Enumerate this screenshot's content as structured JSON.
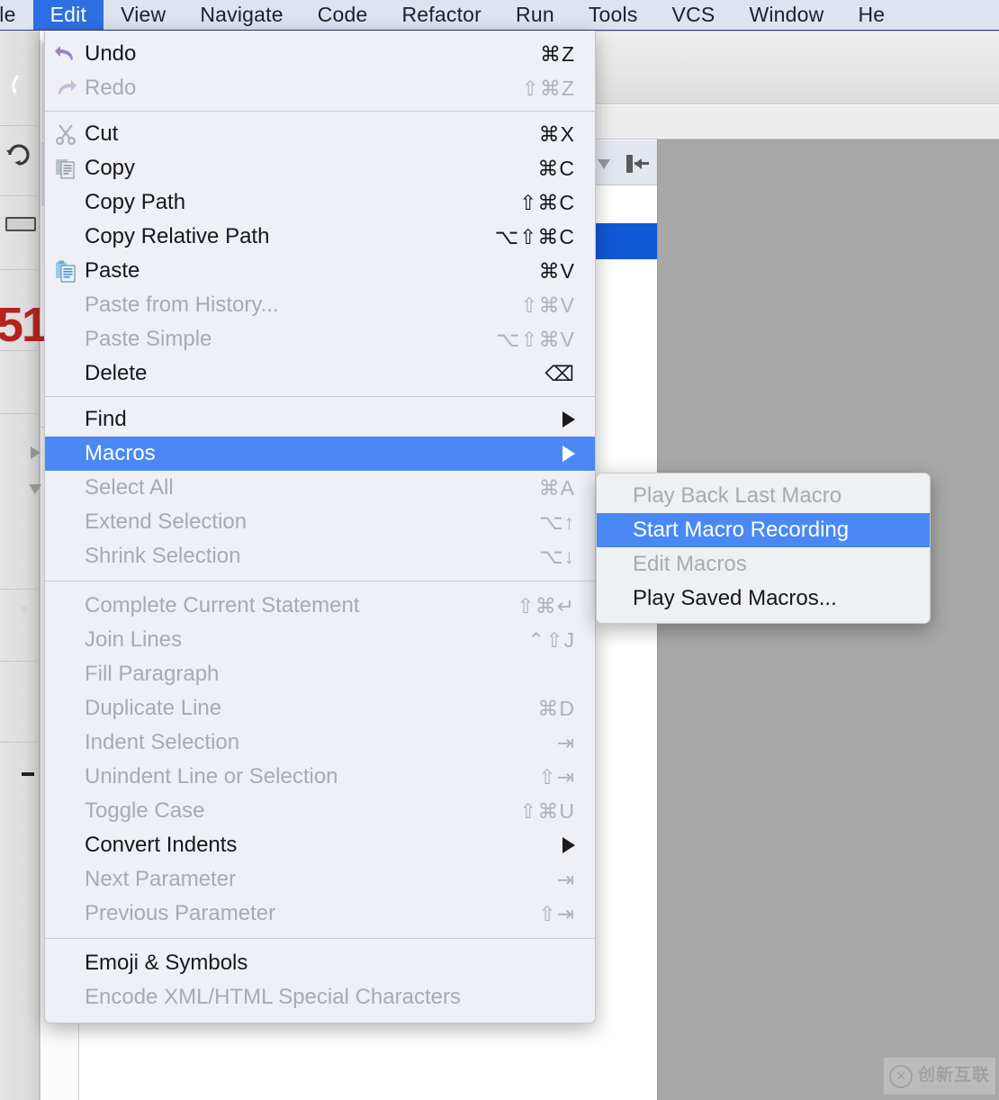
{
  "app": {
    "kind": "ide-menu-screenshot"
  },
  "menubar": {
    "items": [
      {
        "label": "ile",
        "full": "File",
        "selected": false,
        "clipped": true
      },
      {
        "label": "Edit",
        "selected": true
      },
      {
        "label": "View",
        "selected": false
      },
      {
        "label": "Navigate",
        "selected": false
      },
      {
        "label": "Code",
        "selected": false
      },
      {
        "label": "Refactor",
        "selected": false
      },
      {
        "label": "Run",
        "selected": false
      },
      {
        "label": "Tools",
        "selected": false
      },
      {
        "label": "VCS",
        "selected": false
      },
      {
        "label": "Window",
        "selected": false
      },
      {
        "label": "He",
        "full": "Help",
        "selected": false,
        "clipped": true
      }
    ]
  },
  "edit_menu": {
    "groups": [
      {
        "items": [
          {
            "label": "Undo",
            "shortcut": "⌘Z",
            "enabled": true,
            "icon": "undo-icon"
          },
          {
            "label": "Redo",
            "shortcut": "⇧⌘Z",
            "enabled": false,
            "icon": "redo-icon"
          }
        ]
      },
      {
        "items": [
          {
            "label": "Cut",
            "shortcut": "⌘X",
            "enabled": true,
            "icon": "cut-icon"
          },
          {
            "label": "Copy",
            "shortcut": "⌘C",
            "enabled": true,
            "icon": "copy-icon"
          },
          {
            "label": "Copy Path",
            "shortcut": "⇧⌘C",
            "enabled": true,
            "icon": null
          },
          {
            "label": "Copy Relative Path",
            "shortcut": "⌥⇧⌘C",
            "enabled": true,
            "icon": null
          },
          {
            "label": "Paste",
            "shortcut": "⌘V",
            "enabled": true,
            "icon": "paste-icon"
          },
          {
            "label": "Paste from History...",
            "shortcut": "⇧⌘V",
            "enabled": false,
            "icon": null
          },
          {
            "label": "Paste Simple",
            "shortcut": "⌥⇧⌘V",
            "enabled": false,
            "icon": null
          },
          {
            "label": "Delete",
            "shortcut": "⌫",
            "enabled": true,
            "icon": null
          }
        ]
      },
      {
        "items": [
          {
            "label": "Find",
            "shortcut": null,
            "enabled": true,
            "submenu": true
          },
          {
            "label": "Macros",
            "shortcut": null,
            "enabled": true,
            "submenu": true,
            "highlighted": true
          },
          {
            "label": "Select All",
            "shortcut": "⌘A",
            "enabled": false
          },
          {
            "label": "Extend Selection",
            "shortcut": "⌥↑",
            "enabled": false
          },
          {
            "label": "Shrink Selection",
            "shortcut": "⌥↓",
            "enabled": false
          }
        ]
      },
      {
        "items": [
          {
            "label": "Complete Current Statement",
            "shortcut": "⇧⌘↵",
            "enabled": false
          },
          {
            "label": "Join Lines",
            "shortcut": "⌃⇧J",
            "enabled": false
          },
          {
            "label": "Fill Paragraph",
            "shortcut": "",
            "enabled": false
          },
          {
            "label": "Duplicate Line",
            "shortcut": "⌘D",
            "enabled": false
          },
          {
            "label": "Indent Selection",
            "shortcut": "⇥",
            "enabled": false
          },
          {
            "label": "Unindent Line or Selection",
            "shortcut": "⇧⇥",
            "enabled": false
          },
          {
            "label": "Toggle Case",
            "shortcut": "⇧⌘U",
            "enabled": false
          },
          {
            "label": "Convert Indents",
            "shortcut": null,
            "enabled": true,
            "submenu": true
          },
          {
            "label": "Next Parameter",
            "shortcut": "⇥",
            "enabled": false
          },
          {
            "label": "Previous Parameter",
            "shortcut": "⇧⇥",
            "enabled": false
          }
        ]
      },
      {
        "items": [
          {
            "label": "Emoji & Symbols",
            "shortcut": "",
            "enabled": true
          },
          {
            "label": "Encode XML/HTML Special Characters",
            "shortcut": "",
            "enabled": false
          }
        ]
      }
    ]
  },
  "macros_submenu": {
    "items": [
      {
        "label": "Play Back Last Macro",
        "enabled": false,
        "highlighted": false
      },
      {
        "label": "Start Macro Recording",
        "enabled": true,
        "highlighted": true
      },
      {
        "label": "Edit Macros",
        "enabled": false,
        "highlighted": false
      },
      {
        "label": "Play Saved Macros...",
        "enabled": true,
        "highlighted": false
      }
    ]
  },
  "background": {
    "big_red_number": "51"
  },
  "watermark": {
    "text": "创新互联",
    "sub": "CHUANGXIN HULIAN"
  },
  "colors": {
    "menubar_bg": "#dfe3f0",
    "menubar_selected": "#2f6fe4",
    "menu_bg": "#eef0f6",
    "highlight": "#4a89f5",
    "disabled_text": "#a9aab1",
    "enabled_text": "#17181c",
    "editor_gray": "#a8a8a8",
    "tree_selection": "#1158d6"
  }
}
